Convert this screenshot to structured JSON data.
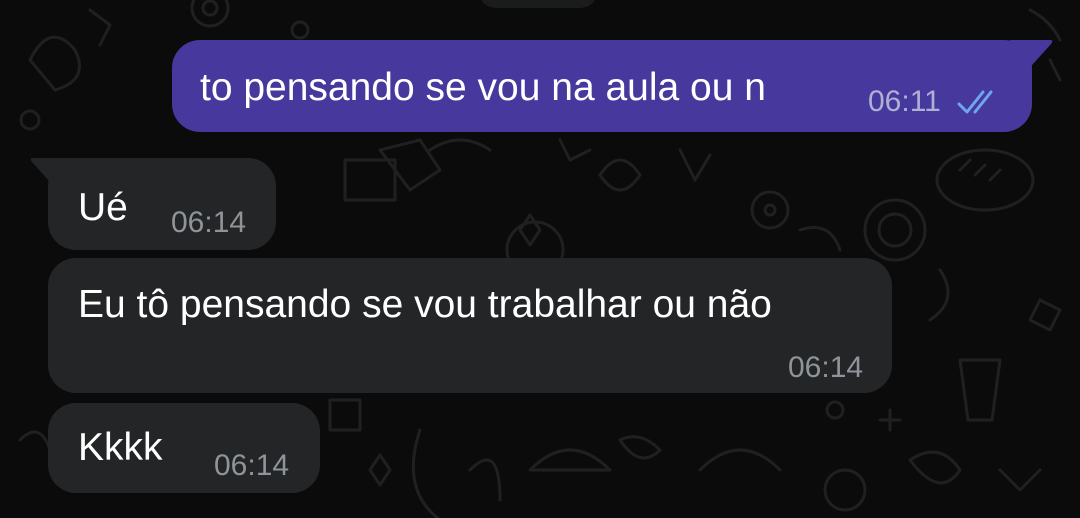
{
  "colors": {
    "background": "#0b0b0c",
    "outgoing_bubble": "#46389d",
    "incoming_bubble": "#232526",
    "read_ticks": "#6fa6ee",
    "timestamp": "#8e9499"
  },
  "messages": [
    {
      "direction": "outgoing",
      "text": "to pensando se vou na aula ou n",
      "time": "06:11",
      "status_icon": "double-check-read-icon"
    },
    {
      "direction": "incoming",
      "text": "Ué",
      "time": "06:14"
    },
    {
      "direction": "incoming",
      "text": "Eu tô pensando se vou trabalhar ou não",
      "time": "06:14"
    },
    {
      "direction": "incoming",
      "text": "Kkkk",
      "time": "06:14"
    }
  ]
}
